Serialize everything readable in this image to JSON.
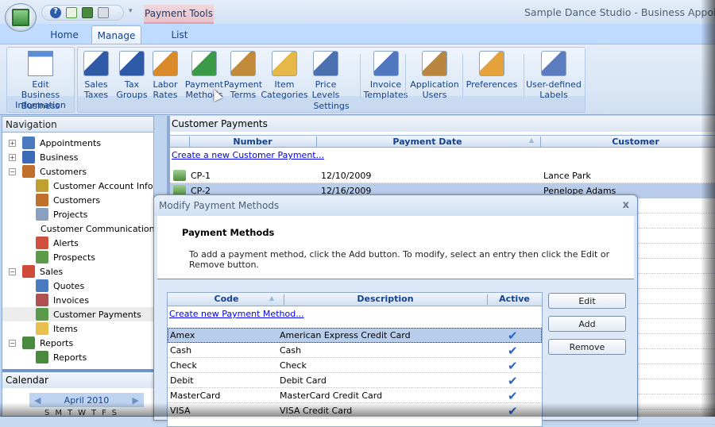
{
  "window": {
    "title": "Sample Dance Studio - Business Appointment"
  },
  "quick_access": [
    {
      "icon": "help-icon"
    },
    {
      "icon": "refresh-icon"
    },
    {
      "icon": "reports-icon"
    },
    {
      "icon": "print-icon"
    }
  ],
  "context_tab": "Payment Tools",
  "tabs": [
    {
      "label": "Home"
    },
    {
      "label": "Manage",
      "active": true
    },
    {
      "label": "List"
    }
  ],
  "ribbon": {
    "groups": [
      {
        "label": "Business",
        "buttons": [
          {
            "label1": "Edit Business",
            "label2": "Information",
            "icon": "edit-business-icon"
          }
        ]
      },
      {
        "label": "Settings",
        "buttons": [
          {
            "label1": "Sales",
            "label2": "Taxes",
            "icon": "sales-tax-icon"
          },
          {
            "label1": "Tax",
            "label2": "Groups",
            "icon": "tax-groups-icon"
          },
          {
            "label1": "Labor",
            "label2": "Rates",
            "icon": "labor-rates-icon"
          },
          {
            "label1": "Payment",
            "label2": "Methods",
            "icon": "payment-methods-icon"
          },
          {
            "label1": "Payment",
            "label2": "Terms",
            "icon": "payment-terms-icon"
          },
          {
            "label1": "Item",
            "label2": "Categories",
            "icon": "item-categories-icon"
          },
          {
            "label1": "Price",
            "label2": "Levels",
            "icon": "price-levels-icon"
          },
          {
            "label1": "Invoice",
            "label2": "Templates",
            "icon": "invoice-templates-icon"
          },
          {
            "label1": "Application",
            "label2": "Users",
            "icon": "application-users-icon"
          },
          {
            "label1": "Preferences",
            "label2": "",
            "icon": "preferences-icon"
          },
          {
            "label1": "User-defined",
            "label2": "Labels",
            "icon": "user-defined-labels-icon"
          }
        ]
      }
    ]
  },
  "navigation": {
    "title": "Navigation",
    "items": [
      {
        "label": "Appointments",
        "level": 0,
        "expander": "+"
      },
      {
        "label": "Business",
        "level": 0,
        "expander": "+"
      },
      {
        "label": "Customers",
        "level": 0,
        "expander": "-"
      },
      {
        "label": "Customer Account Info",
        "level": 1
      },
      {
        "label": "Customers",
        "level": 1
      },
      {
        "label": "Projects",
        "level": 1
      },
      {
        "label": "Customer Communications",
        "level": 1
      },
      {
        "label": "Alerts",
        "level": 1
      },
      {
        "label": "Prospects",
        "level": 1
      },
      {
        "label": "Sales",
        "level": 0,
        "expander": "-"
      },
      {
        "label": "Quotes",
        "level": 1
      },
      {
        "label": "Invoices",
        "level": 1
      },
      {
        "label": "Customer Payments",
        "level": 1,
        "selected": true
      },
      {
        "label": "Items",
        "level": 1
      },
      {
        "label": "Reports",
        "level": 0,
        "expander": "-"
      },
      {
        "label": "Reports",
        "level": 1
      }
    ]
  },
  "calendar": {
    "title": "Calendar",
    "month": "April 2010",
    "days": "SMTWTFS"
  },
  "main": {
    "title": "Customer Payments",
    "columns": [
      "Number",
      "Payment Date",
      "Customer"
    ],
    "create_link": "Create a new Customer Payment...",
    "rows": [
      {
        "number": "CP-1",
        "date": "12/10/2009",
        "customer": "Lance Park"
      },
      {
        "number": "CP-2",
        "date": "12/16/2009",
        "customer": "Penelope Adams",
        "selected": true
      }
    ]
  },
  "dialog": {
    "title": "Modify Payment Methods",
    "heading": "Payment Methods",
    "instructions": "To add a payment method, click the Add button. To modify, select an entry then click the Edit or Remove button.",
    "columns": [
      "Code",
      "Description",
      "Active"
    ],
    "create_link": "Create new Payment Method...",
    "rows": [
      {
        "code": "Amex",
        "description": "American Express Credit Card",
        "active": true,
        "selected": true
      },
      {
        "code": "Cash",
        "description": "Cash",
        "active": true
      },
      {
        "code": "Check",
        "description": "Check",
        "active": true
      },
      {
        "code": "Debit",
        "description": "Debit Card",
        "active": true
      },
      {
        "code": "MasterCard",
        "description": "MasterCard Credit Card",
        "active": true
      },
      {
        "code": "VISA",
        "description": "VISA Credit Card",
        "active": true
      }
    ],
    "buttons": {
      "edit": "Edit",
      "add": "Add",
      "remove": "Remove"
    },
    "close_glyph": "x"
  }
}
